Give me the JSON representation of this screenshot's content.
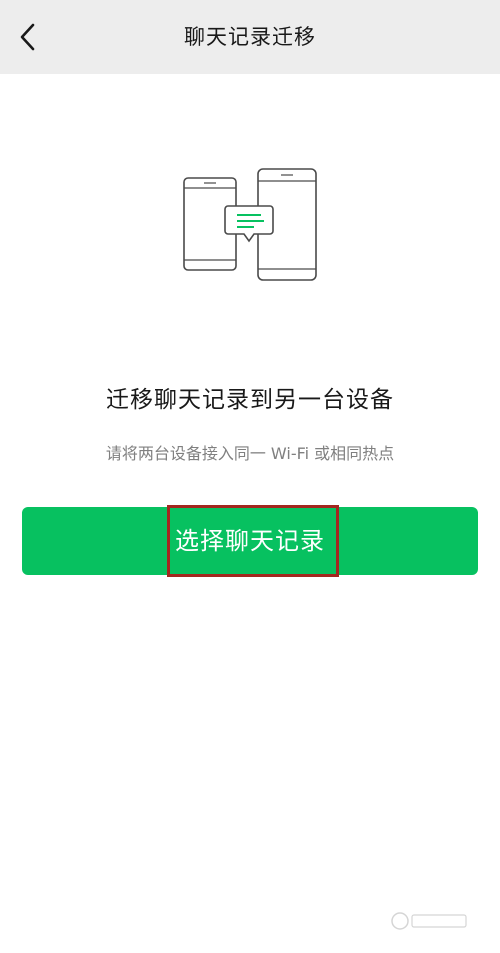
{
  "nav": {
    "back_icon": "chevron-left-icon",
    "title": "聊天记录迁移"
  },
  "illustration": {
    "icon": "phones-transfer-icon",
    "accent_color": "#07c160"
  },
  "content": {
    "headline": "迁移聊天记录到另一台设备",
    "hint": "请将两台设备接入同一 Wi-Fi 或相同热点"
  },
  "primary_button": {
    "label": "选择聊天记录",
    "color": "#07c160",
    "highlight_color": "#a3271f"
  },
  "watermark": {
    "icon": "baidu-jingyan-watermark"
  }
}
